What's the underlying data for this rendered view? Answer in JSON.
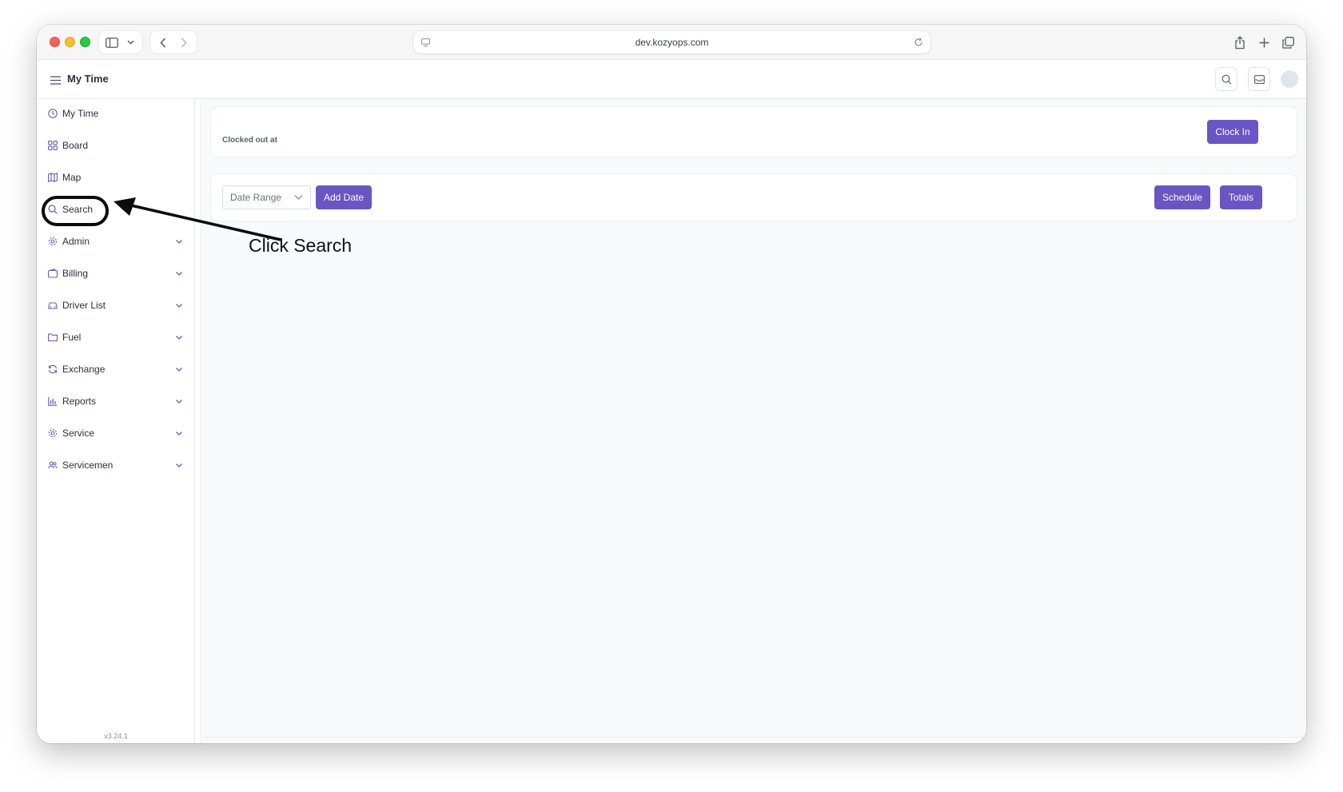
{
  "browser": {
    "url": "dev.kozyops.com"
  },
  "header": {
    "title": "My Time"
  },
  "sidebar": {
    "items": [
      {
        "label": "My Time",
        "icon": "clock-icon",
        "expandable": false
      },
      {
        "label": "Board",
        "icon": "grid-icon",
        "expandable": false
      },
      {
        "label": "Map",
        "icon": "map-icon",
        "expandable": false
      },
      {
        "label": "Search",
        "icon": "search-icon",
        "expandable": false
      },
      {
        "label": "Admin",
        "icon": "gear-icon",
        "expandable": true
      },
      {
        "label": "Billing",
        "icon": "wallet-icon",
        "expandable": true
      },
      {
        "label": "Driver List",
        "icon": "car-icon",
        "expandable": true
      },
      {
        "label": "Fuel",
        "icon": "folder-icon",
        "expandable": true
      },
      {
        "label": "Exchange",
        "icon": "refresh-icon",
        "expandable": true
      },
      {
        "label": "Reports",
        "icon": "bar-chart-icon",
        "expandable": true
      },
      {
        "label": "Service",
        "icon": "gear-icon",
        "expandable": true
      },
      {
        "label": "Servicemen",
        "icon": "users-icon",
        "expandable": true
      }
    ],
    "version": "v3.24.1"
  },
  "clock_card": {
    "status": "Clocked out at",
    "clock_in_label": "Clock In"
  },
  "toolbar": {
    "date_range_placeholder": "Date Range",
    "add_date_label": "Add Date",
    "schedule_label": "Schedule",
    "totals_label": "Totals"
  },
  "annotation": {
    "text": "Click Search"
  },
  "colors": {
    "accent": "#6a55c4"
  }
}
